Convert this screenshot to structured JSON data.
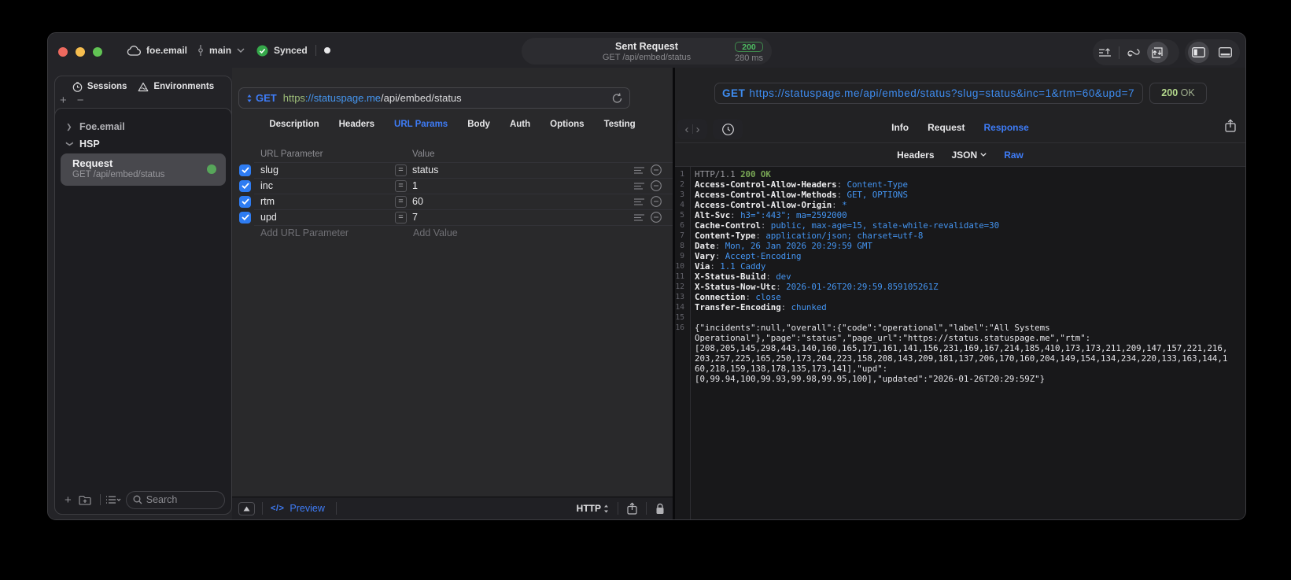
{
  "titlebar": {
    "project": "foe.email",
    "branch": "main",
    "sync_status": "Synced",
    "center": {
      "title": "Sent Request",
      "subtitle": "GET /api/embed/status",
      "status_code": "200",
      "duration": "280 ms"
    }
  },
  "sidebar": {
    "tabs": [
      {
        "label": "Sessions",
        "icon": "clock-icon"
      },
      {
        "label": "Environments",
        "icon": "environments-icon"
      }
    ],
    "tree": [
      {
        "label": "Foe.email",
        "expanded": false
      },
      {
        "label": "HSP",
        "expanded": true
      }
    ],
    "request_item": {
      "title": "Request",
      "subtitle": "GET /api/embed/status",
      "selected": true,
      "status_dot_color": "#57a65a"
    },
    "search_placeholder": "Search"
  },
  "request_editor": {
    "method": "GET",
    "url_scheme": "https",
    "url_host": "://statuspage.me",
    "url_path": "/api/embed/status",
    "tabs": [
      "Description",
      "Headers",
      "URL Params",
      "Body",
      "Auth",
      "Options",
      "Testing"
    ],
    "active_tab": "URL Params",
    "param_table": {
      "columns": [
        "URL Parameter",
        "Value"
      ],
      "rows": [
        {
          "key": "slug",
          "value": "status",
          "checked": true
        },
        {
          "key": "inc",
          "value": "1",
          "checked": true
        },
        {
          "key": "rtm",
          "value": "60",
          "checked": true
        },
        {
          "key": "upd",
          "value": "7",
          "checked": true
        }
      ],
      "add_key_label": "Add URL Parameter",
      "add_value_label": "Add Value"
    },
    "bottom_bar": {
      "preview_label": "Preview",
      "protocol": "HTTP"
    }
  },
  "response_viewer": {
    "request_method": "GET",
    "request_url": "https://statuspage.me/api/embed/status?slug=status&inc=1&rtm=60&upd=7",
    "status_code": "200",
    "status_text": "OK",
    "tabs": [
      "Info",
      "Request",
      "Response"
    ],
    "active_tab": "Response",
    "subtabs": [
      "Headers",
      "JSON",
      "Raw"
    ],
    "active_subtab": "Raw",
    "http_version": "HTTP/1.1",
    "status_line": "200 OK",
    "headers": [
      {
        "name": "Access-Control-Allow-Headers",
        "value": "Content-Type"
      },
      {
        "name": "Access-Control-Allow-Methods",
        "value": "GET, OPTIONS"
      },
      {
        "name": "Access-Control-Allow-Origin",
        "value": "*"
      },
      {
        "name": "Alt-Svc",
        "value": "h3=\":443\"; ma=2592000"
      },
      {
        "name": "Cache-Control",
        "value": "public, max-age=15, stale-while-revalidate=30"
      },
      {
        "name": "Content-Type",
        "value": "application/json; charset=utf-8"
      },
      {
        "name": "Date",
        "value": "Mon, 26 Jan 2026 20:29:59 GMT"
      },
      {
        "name": "Vary",
        "value": "Accept-Encoding"
      },
      {
        "name": "Via",
        "value": "1.1 Caddy"
      },
      {
        "name": "X-Status-Build",
        "value": "dev"
      },
      {
        "name": "X-Status-Now-Utc",
        "value": "2026-01-26T20:29:59.859105261Z"
      },
      {
        "name": "Connection",
        "value": "close"
      },
      {
        "name": "Transfer-Encoding",
        "value": "chunked"
      }
    ],
    "body_lines": [
      "{\"incidents\":null,\"overall\":{\"code\":\"operational\",\"label\":\"All Systems",
      "Operational\"},\"page\":\"status\",\"page_url\":\"https://status.statuspage.me\",\"rtm\":",
      "[208,205,145,298,443,140,160,165,171,161,141,156,231,169,167,214,185,410,173,173,211,209,147,157,221,216,",
      "203,257,225,165,250,173,204,223,158,208,143,209,181,137,206,170,160,204,149,154,134,234,220,133,163,144,1",
      "60,218,159,138,178,135,173,141],\"upd\":",
      "[0,99.94,100,99.93,99.98,99.95,100],\"updated\":\"2026-01-26T20:29:59Z\"}"
    ]
  }
}
